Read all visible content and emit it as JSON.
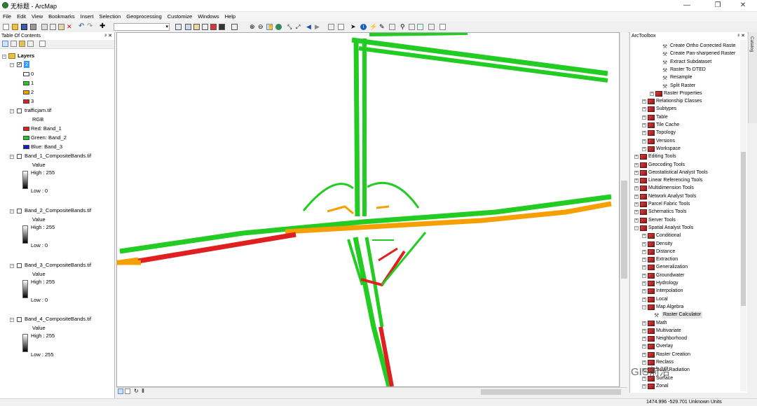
{
  "window": {
    "title": "无标题 - ArcMap",
    "controls": [
      "—",
      "❐",
      "✕"
    ]
  },
  "menu": [
    "File",
    "Edit",
    "View",
    "Bookmarks",
    "Insert",
    "Selection",
    "Geoprocessing",
    "Customize",
    "Windows",
    "Help"
  ],
  "toc": {
    "title": "Table Of Contents",
    "pin": "ᵖ ✕",
    "layers_label": "Layers",
    "group_2": {
      "name": "2",
      "classes": [
        {
          "label": "0",
          "color": "#ffffff"
        },
        {
          "label": "1",
          "color": "#22cc22"
        },
        {
          "label": "2",
          "color": "#f5a000"
        },
        {
          "label": "3",
          "color": "#e02020"
        }
      ]
    },
    "traffic": {
      "name": "trafficjam.tif",
      "sub": "RGB",
      "bands": [
        {
          "label": "Red:   Band_1",
          "color": "#e02020"
        },
        {
          "label": "Green: Band_2",
          "color": "#22cc22"
        },
        {
          "label": "Blue:  Band_3",
          "color": "#1a1acc"
        }
      ]
    },
    "band_layers": [
      {
        "name": "Band_1_CompositeBands.tif",
        "value": "Value",
        "high": "High : 255",
        "low": "Low : 0"
      },
      {
        "name": "Band_2_CompositeBands.tif",
        "value": "Value",
        "high": "High : 255",
        "low": "Low : 0"
      },
      {
        "name": "Band_3_CompositeBands.tif",
        "value": "Value",
        "high": "High : 255",
        "low": "Low : 0"
      },
      {
        "name": "Band_4_CompositeBands.tif",
        "value": "Value",
        "high": "High : 255",
        "low": "Low : 255"
      }
    ]
  },
  "arctoolbox": {
    "title": "ArcToolbox",
    "pin": "ᵖ ✕",
    "items": [
      {
        "label": "Create Ortho Corrected Raste",
        "kind": "tool",
        "level": 3
      },
      {
        "label": "Create Pan-sharpened Raster",
        "kind": "tool",
        "level": 3
      },
      {
        "label": "Extract Subdataset",
        "kind": "tool",
        "level": 3
      },
      {
        "label": "Raster To DTED",
        "kind": "tool",
        "level": 3
      },
      {
        "label": "Resample",
        "kind": "tool",
        "level": 3
      },
      {
        "label": "Split Raster",
        "kind": "tool",
        "level": 3
      },
      {
        "label": "Raster Properties",
        "kind": "box",
        "level": 2
      },
      {
        "label": "Relationship Classes",
        "kind": "box",
        "level": 1
      },
      {
        "label": "Subtypes",
        "kind": "box",
        "level": 1
      },
      {
        "label": "Table",
        "kind": "box",
        "level": 1
      },
      {
        "label": "Tile Cache",
        "kind": "box",
        "level": 1
      },
      {
        "label": "Topology",
        "kind": "box",
        "level": 1
      },
      {
        "label": "Versions",
        "kind": "box",
        "level": 1
      },
      {
        "label": "Workspace",
        "kind": "box",
        "level": 1
      },
      {
        "label": "Editing Tools",
        "kind": "box",
        "level": 0
      },
      {
        "label": "Geocoding Tools",
        "kind": "box",
        "level": 0
      },
      {
        "label": "Geostatistical Analyst Tools",
        "kind": "box",
        "level": 0
      },
      {
        "label": "Linear Referencing Tools",
        "kind": "box",
        "level": 0
      },
      {
        "label": "Multidimension Tools",
        "kind": "box",
        "level": 0
      },
      {
        "label": "Network Analyst Tools",
        "kind": "box",
        "level": 0
      },
      {
        "label": "Parcel Fabric Tools",
        "kind": "box",
        "level": 0
      },
      {
        "label": "Schematics Tools",
        "kind": "box",
        "level": 0
      },
      {
        "label": "Server Tools",
        "kind": "box",
        "level": 0
      },
      {
        "label": "Spatial Analyst Tools",
        "kind": "box",
        "level": 0,
        "expanded": true
      },
      {
        "label": "Conditional",
        "kind": "box",
        "level": 1
      },
      {
        "label": "Density",
        "kind": "box",
        "level": 1
      },
      {
        "label": "Distance",
        "kind": "box",
        "level": 1
      },
      {
        "label": "Extraction",
        "kind": "box",
        "level": 1
      },
      {
        "label": "Generalization",
        "kind": "box",
        "level": 1
      },
      {
        "label": "Groundwater",
        "kind": "box",
        "level": 1
      },
      {
        "label": "Hydrology",
        "kind": "box",
        "level": 1
      },
      {
        "label": "Interpolation",
        "kind": "box",
        "level": 1
      },
      {
        "label": "Local",
        "kind": "box",
        "level": 1
      },
      {
        "label": "Map Algebra",
        "kind": "box",
        "level": 1,
        "expanded": true
      },
      {
        "label": "Raster Calculator",
        "kind": "tool",
        "level": 2,
        "selected": true
      },
      {
        "label": "Math",
        "kind": "box",
        "level": 1
      },
      {
        "label": "Multivariate",
        "kind": "box",
        "level": 1
      },
      {
        "label": "Neighborhood",
        "kind": "box",
        "level": 1
      },
      {
        "label": "Overlay",
        "kind": "box",
        "level": 1
      },
      {
        "label": "Raster Creation",
        "kind": "box",
        "level": 1
      },
      {
        "label": "Reclass",
        "kind": "box",
        "level": 1
      },
      {
        "label": "Solar Radiation",
        "kind": "box",
        "level": 1
      },
      {
        "label": "Surface",
        "kind": "box",
        "level": 1
      },
      {
        "label": "Zonal",
        "kind": "box",
        "level": 1
      }
    ]
  },
  "catalog_tab": "Catalog",
  "status": {
    "coordinates": "1474.996  -529.701 Unknown Units"
  },
  "watermark": "GIS前沿",
  "colors": {
    "green": "#22cc22",
    "orange": "#f5a000",
    "red": "#e02020",
    "toolbox_red": "#b22222"
  }
}
